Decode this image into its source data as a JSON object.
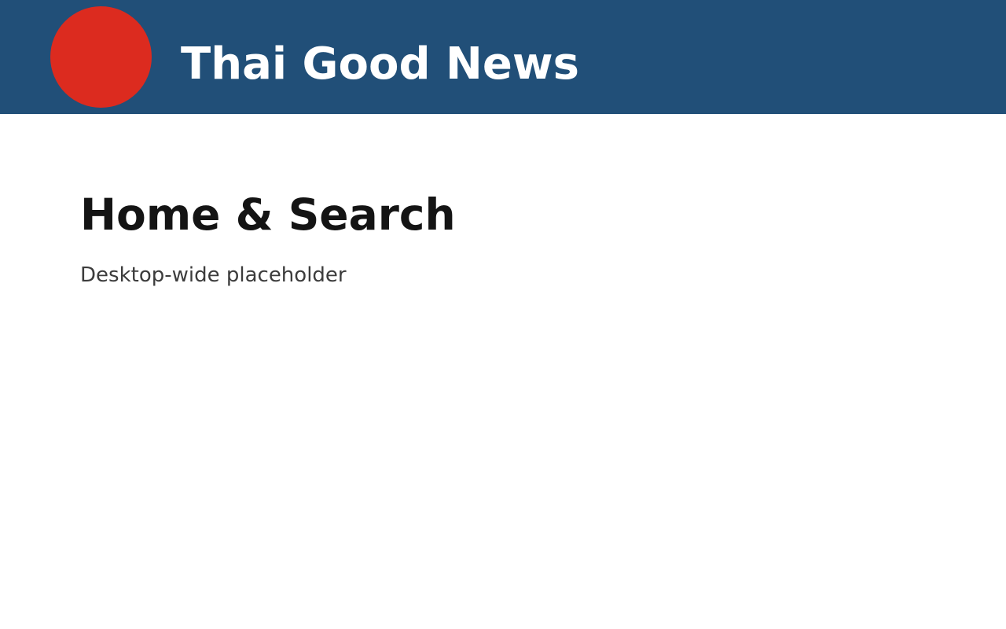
{
  "header": {
    "title": "Thai Good News",
    "background_color": "#214f78",
    "logo": {
      "icon": "red-circle-logo",
      "color": "#dc2b1f"
    }
  },
  "main": {
    "title": "Home & Search",
    "subtitle": "Desktop-wide placeholder"
  }
}
